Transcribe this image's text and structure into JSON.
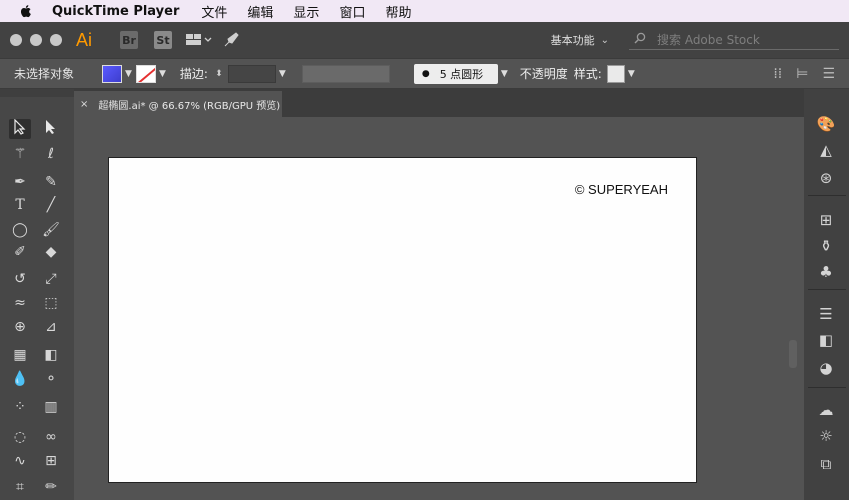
{
  "menubar": {
    "app_name": "QuickTime Player",
    "items": [
      "文件",
      "编辑",
      "显示",
      "窗口",
      "帮助"
    ]
  },
  "appbar": {
    "ai_logo": "Ai",
    "br_label": "Br",
    "st_label": "St",
    "workspace": "基本功能",
    "search_placeholder": "搜索 Adobe Stock"
  },
  "control": {
    "no_selection": "未选择对象",
    "stroke_label": "描边:",
    "brush_label": "5 点圆形",
    "opacity_label": "不透明度",
    "style_label": "样式:"
  },
  "document": {
    "tab_title": "超椭圆.ai* @ 66.67% (RGB/GPU 预览)",
    "close_glyph": "×"
  },
  "artboard": {
    "copyright": "© SUPERYEAH"
  },
  "colors": {
    "accent_ai": "#ff9a00",
    "fill_swatch": "#4d4dee",
    "stroke_none": "#e53030"
  }
}
